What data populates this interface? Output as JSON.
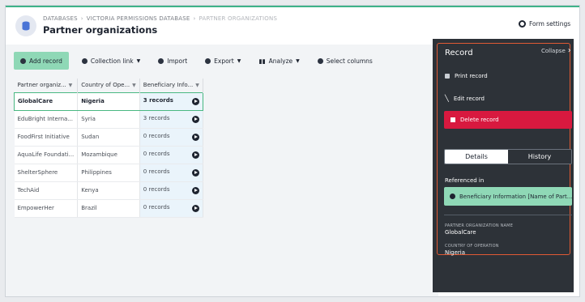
{
  "header": {
    "breadcrumb": [
      "DATABASES",
      "VICTORIA PERMISSIONS DATABASE",
      "PARTNER ORGANIZATIONS"
    ],
    "title": "Partner organizations",
    "form_settings": "Form settings"
  },
  "toolbar": {
    "add_record": "Add record",
    "collection_link": "Collection link",
    "import": "Import",
    "export": "Export",
    "analyze": "Analyze",
    "select_columns": "Select columns"
  },
  "table": {
    "columns": [
      "Partner organiz...",
      "Country of Ope...",
      "Beneficiary Info..."
    ],
    "rows": [
      [
        "GlobalCare",
        "Nigeria",
        "3 records"
      ],
      [
        "EduBright Interna...",
        "Syria",
        "3 records"
      ],
      [
        "FoodFirst Initiative",
        "Sudan",
        "0 records"
      ],
      [
        "AquaLife Foundati...",
        "Mozambique",
        "0 records"
      ],
      [
        "ShelterSphere",
        "Philippines",
        "0 records"
      ],
      [
        "TechAid",
        "Kenya",
        "0 records"
      ],
      [
        "EmpowerHer",
        "Brazil",
        "0 records"
      ]
    ]
  },
  "record_panel": {
    "title": "Record",
    "collapse": "Collapse",
    "print": "Print record",
    "edit": "Edit record",
    "delete": "Delete record",
    "tab_details": "Details",
    "tab_history": "History",
    "referenced_in": "Referenced in",
    "reference_item": "Beneficiary Information [Name of Part...",
    "field1_label": "PARTNER ORGANIZATION NAME",
    "field1_value": "GlobalCare",
    "field2_label": "COUNTRY OF OPERATION",
    "field2_value": "Nigeria"
  },
  "colors": {
    "accent": "#8fd8b6",
    "delete": "#d8193f",
    "panel": "#2d3238",
    "highlight": "#e05a34"
  }
}
